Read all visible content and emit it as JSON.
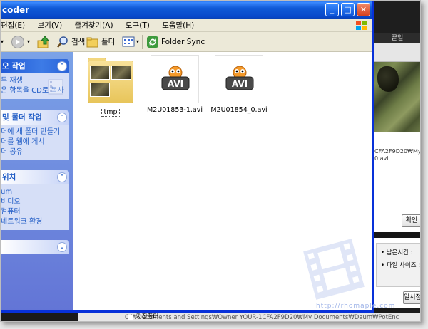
{
  "window": {
    "title": "coder",
    "buttons": {
      "minimize": "_",
      "maximize": "□",
      "close": "✕"
    }
  },
  "menubar": {
    "items": [
      "편집(E)",
      "보기(V)",
      "즐겨찾기(A)",
      "도구(T)",
      "도움말(H)"
    ]
  },
  "toolbar": {
    "search_label": "검색",
    "folders_label": "폴더",
    "folder_sync_label": "Folder Sync"
  },
  "taskpane": {
    "video_tasks": {
      "header": "오 작업",
      "items": [
        "두 재생",
        "은 항목을 CD로 복사"
      ]
    },
    "file_folder_tasks": {
      "header": "및 폴더 작업",
      "items": [
        "더에 새 폴더 만들기",
        "더를 웹에 게시",
        "더 공유"
      ]
    },
    "other_places": {
      "header": "위치",
      "items": [
        "um",
        "비디오",
        "컴퓨터",
        "네트워크 환경"
      ]
    },
    "details": {
      "header": ""
    }
  },
  "files": [
    {
      "name": "tmp",
      "type": "folder",
      "selected": true
    },
    {
      "name": "M2U01853-1.avi",
      "type": "avi"
    },
    {
      "name": "M2U01854_0.avi",
      "type": "avi"
    }
  ],
  "background_app": {
    "tab_label": "끝얼",
    "path_text": [
      "CFA2F9D20₩My",
      "0.avi"
    ],
    "ok_button": "확인",
    "remaining_time_label": "남은시간 :",
    "file_size_label": "파일 사이즈 :",
    "pause_button": "일시정",
    "save_folder_label": "저장폴더",
    "save_path": "C:₩Documents and Settings₩Owner YOUR-1CFA2F9D20₩My Documents₩Daum₩PotEnc"
  },
  "watermark_text": "http://rhomaple.com",
  "colors": {
    "title_blue": "#0a5fe8",
    "taskpane_blue": "#6375d6",
    "link_blue": "#215dc6",
    "close_red": "#d6411d"
  }
}
